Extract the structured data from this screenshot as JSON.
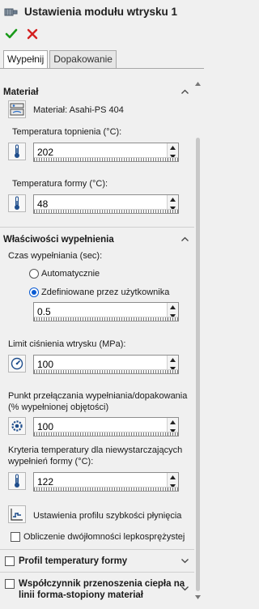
{
  "title": "Ustawienia modułu wtrysku 1",
  "tabs": {
    "fill": "Wypełnij",
    "pack": "Dopakowanie"
  },
  "material": {
    "section": "Materiał",
    "name": "Materiał: Asahi-PS 404",
    "melt_label": "Temperatura topnienia (°C):",
    "melt_value": "202",
    "mold_label": "Temperatura formy (°C):",
    "mold_value": "48"
  },
  "fill": {
    "section": "Właściwości wypełnienia",
    "time_label": "Czas wypełniania (sec):",
    "auto_label": "Automatycznie",
    "user_label": "Zdefiniowane przez użytkownika",
    "time_value": "0.5",
    "pressure_label": "Limit ciśnienia wtrysku (MPa):",
    "pressure_value": "100",
    "switch_label_1": "Punkt przełączania wypełniania/dopakowania",
    "switch_label_2": "(% wypełnionej objętości)",
    "switch_value": "100",
    "short_label_1": "Kryteria temperatury dla niewystarczających",
    "short_label_2": "wypełnień formy  (°C):",
    "short_value": "122",
    "flow_profile_label": "Ustawienia profilu szybkości płynięcia",
    "birefringence_label": "Obliczenie dwójłomności lepkosprężystej"
  },
  "sections": {
    "mold_temp_profile": "Profil temperatury formy",
    "htc_1": "Współczynnik przenoszenia ciepła na",
    "htc_2": "linii forma-stopiony materiał"
  },
  "colors": {
    "ok": "#1a9a1a",
    "cancel": "#d42020",
    "accent": "#0a5bd3"
  }
}
